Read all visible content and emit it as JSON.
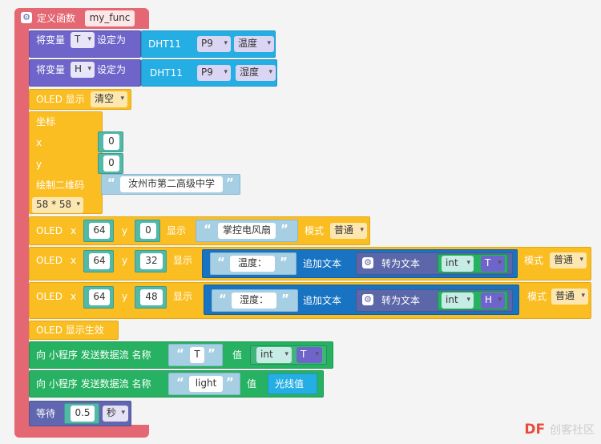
{
  "func": {
    "label": "定义函数",
    "name": "my_func"
  },
  "set_t": {
    "prefix": "将变量",
    "var": "T",
    "suffix": "设定为",
    "sensor": "DHT11",
    "pin": "P9",
    "reading": "温度"
  },
  "set_h": {
    "prefix": "将变量",
    "var": "H",
    "suffix": "设定为",
    "sensor": "DHT11",
    "pin": "P9",
    "reading": "湿度"
  },
  "oled_clear": {
    "label": "OLED 显示",
    "option": "清空"
  },
  "qr": {
    "coord_label": "坐标",
    "x_label": "x",
    "x_value": "0",
    "y_label": "y",
    "y_value": "0",
    "draw_label": "绘制二维码",
    "text": "汝州市第二高级中学",
    "size": "58 * 58"
  },
  "oled1": {
    "oled": "OLED",
    "x": "x",
    "x_val": "64",
    "y": "y",
    "y_val": "0",
    "show": "显示",
    "text": "掌控电风扇",
    "mode": "模式",
    "mode_val": "普通"
  },
  "oled2": {
    "oled": "OLED",
    "x": "x",
    "x_val": "64",
    "y": "y",
    "y_val": "32",
    "show": "显示",
    "text": "温度：",
    "append": "追加文本",
    "to_text": "转为文本",
    "cast": "int",
    "var": "T",
    "mode": "模式",
    "mode_val": "普通"
  },
  "oled3": {
    "oled": "OLED",
    "x": "x",
    "x_val": "64",
    "y": "y",
    "y_val": "48",
    "show": "显示",
    "text": "湿度：",
    "append": "追加文本",
    "to_text": "转为文本",
    "cast": "int",
    "var": "H",
    "mode": "模式",
    "mode_val": "普通"
  },
  "oled_show": {
    "label": "OLED 显示生效"
  },
  "send1": {
    "label": "向 小程序 发送数据流 名称",
    "name": "T",
    "value_label": "值",
    "cast": "int",
    "var": "T"
  },
  "send2": {
    "label": "向 小程序 发送数据流 名称",
    "name": "light",
    "value_label": "值",
    "sensor": "光线值"
  },
  "wait": {
    "label": "等待",
    "value": "0.5",
    "unit": "秒"
  },
  "watermark": {
    "brand": "DF",
    "rest": "创客社区"
  }
}
